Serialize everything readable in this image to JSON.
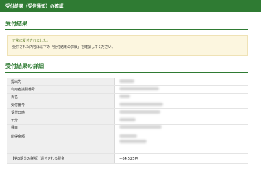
{
  "header": {
    "title": "受付結果（受信通知）の確認"
  },
  "result_section": {
    "title": "受付結果"
  },
  "notice": {
    "success": "正常に受付されました。",
    "instruction": "受付された内容は以下の「受付結果の詳細」を確認してください。"
  },
  "details_section": {
    "title": "受付結果の詳細"
  },
  "details": {
    "rows": [
      {
        "label": "提出先"
      },
      {
        "label": "利用者識別番号"
      },
      {
        "label": "氏名"
      },
      {
        "label": "受付番号"
      },
      {
        "label": "受付日時"
      },
      {
        "label": "年分"
      },
      {
        "label": "種目"
      },
      {
        "label": "所得金額"
      }
    ],
    "tax_row": {
      "label": "【第3期分の税額】還付される税金",
      "value": "−64,525円"
    }
  }
}
